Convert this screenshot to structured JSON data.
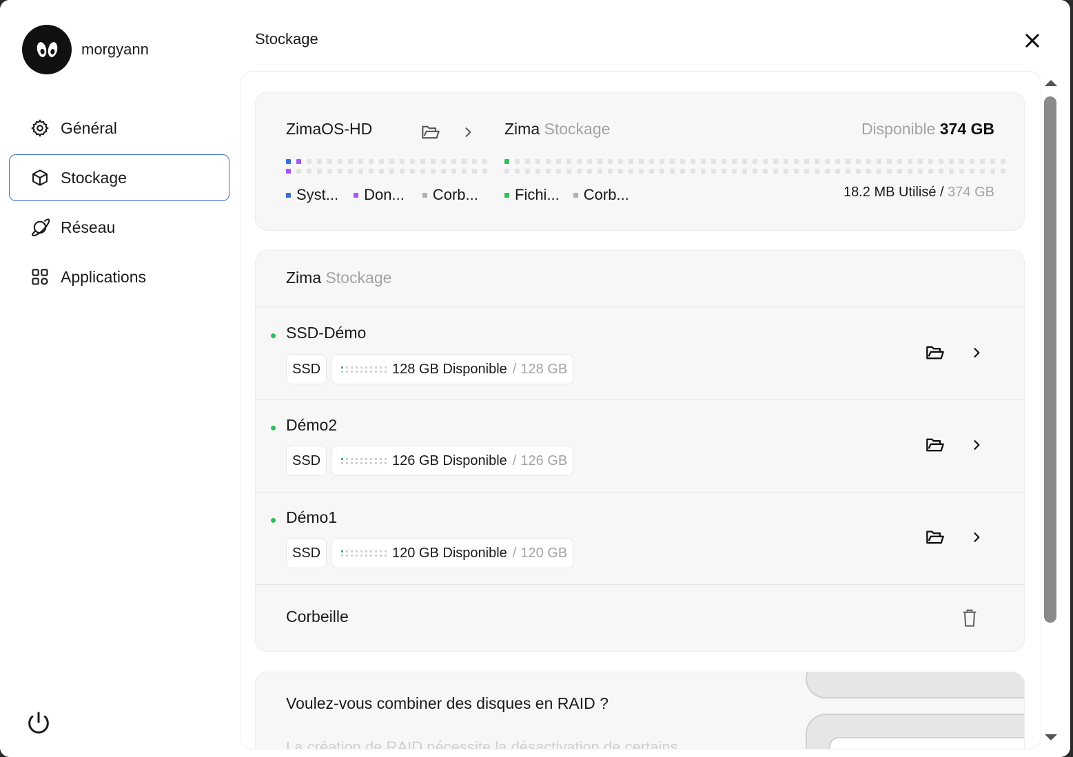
{
  "user": {
    "name": "morgyann"
  },
  "nav": [
    {
      "label": "Général",
      "icon": "gear-icon"
    },
    {
      "label": "Stockage",
      "icon": "cube-icon",
      "active": true
    },
    {
      "label": "Réseau",
      "icon": "planet-icon"
    },
    {
      "label": "Applications",
      "icon": "grid-icon"
    }
  ],
  "header": {
    "title": "Stockage"
  },
  "summary": {
    "disk": "ZimaOS-HD",
    "storage_primary": "Zima",
    "storage_secondary": "Stockage",
    "available_label": "Disponible",
    "available_value": "374 GB",
    "legend_left": [
      {
        "label": "Syst...",
        "color": "#3b6fd8"
      },
      {
        "label": "Don...",
        "color": "#a855f7"
      },
      {
        "label": "Corb...",
        "color": "#b0b0b0"
      }
    ],
    "legend_right": [
      {
        "label": "Fichi...",
        "color": "#2fbf5a"
      },
      {
        "label": "Corb...",
        "color": "#b0b0b0"
      }
    ],
    "used_value": "18.2 MB Utilisé",
    "used_total": "374 GB"
  },
  "pools": {
    "title_primary": "Zima",
    "title_secondary": "Stockage",
    "items": [
      {
        "name": "SSD-Démo",
        "type": "SSD",
        "available": "128 GB Disponible",
        "total": "128 GB"
      },
      {
        "name": "Démo2",
        "type": "SSD",
        "available": "126 GB Disponible",
        "total": "126 GB"
      },
      {
        "name": "Démo1",
        "type": "SSD",
        "available": "120 GB Disponible",
        "total": "120 GB"
      }
    ],
    "trash_label": "Corbeille"
  },
  "raid": {
    "question": "Voulez-vous combiner des disques en RAID ?",
    "subtitle": "La création de RAID nécessite la désactivation de certains"
  },
  "colors": {
    "accent": "#3b6fd8",
    "green": "#2fbf5a",
    "purple": "#a855f7"
  }
}
